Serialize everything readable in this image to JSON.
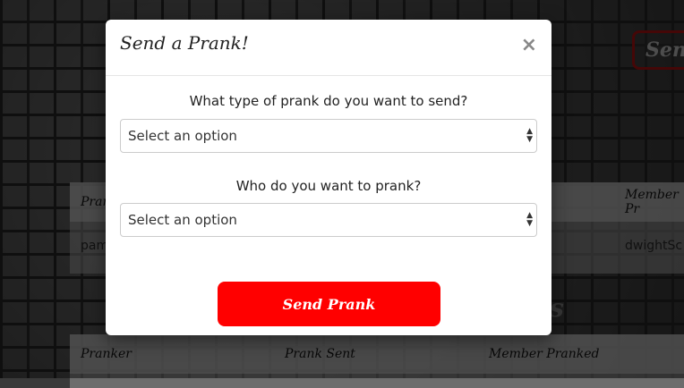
{
  "background": {
    "top_button_label": "Send",
    "table1": {
      "headers": [
        "Pranker",
        "Member Pr"
      ],
      "row": [
        "pam",
        "dwightSc"
      ]
    },
    "heading2_fragment": "s",
    "table2": {
      "headers": [
        "Pranker",
        "Prank Sent",
        "Member Pranked"
      ]
    }
  },
  "modal": {
    "title": "Send a Prank!",
    "close_label": "×",
    "prank_type": {
      "label": "What type of prank do you want to send?",
      "selected": "Select an option"
    },
    "target": {
      "label": "Who do you want to prank?",
      "selected": "Select an option"
    },
    "submit_label": "Send Prank"
  },
  "colors": {
    "submit": "#ff0000",
    "top_button_border": "#8b0f0f"
  }
}
